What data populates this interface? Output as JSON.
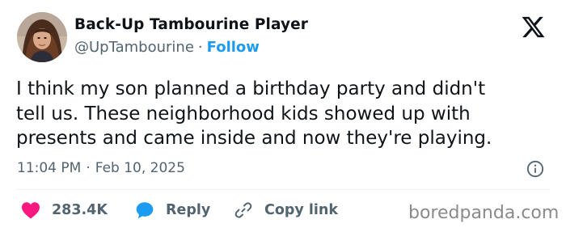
{
  "author": {
    "name": "Back-Up Tambourine Player",
    "handle": "@UpTambourine",
    "separator": "·",
    "follow_label": "Follow"
  },
  "tweet": {
    "text_lines": [
      "I think my son planned a birthday party and didn't",
      "tell us. These neighborhood kids showed up with",
      "presents and came inside and now they're playing."
    ],
    "time": "11:04 PM",
    "separator": "·",
    "date": "Feb 10, 2025"
  },
  "actions": {
    "like_count": "283.4K",
    "reply_label": "Reply",
    "copy_label": "Copy link"
  },
  "watermark": "boredpanda.com",
  "icons": {
    "logo": "x-logo-icon",
    "info": "info-icon",
    "like": "heart-icon",
    "reply": "speech-bubble-icon",
    "copy": "link-icon"
  },
  "colors": {
    "accent": "#1d9bf0",
    "like": "#f91880",
    "text": "#0f1419",
    "muted": "#536471"
  }
}
